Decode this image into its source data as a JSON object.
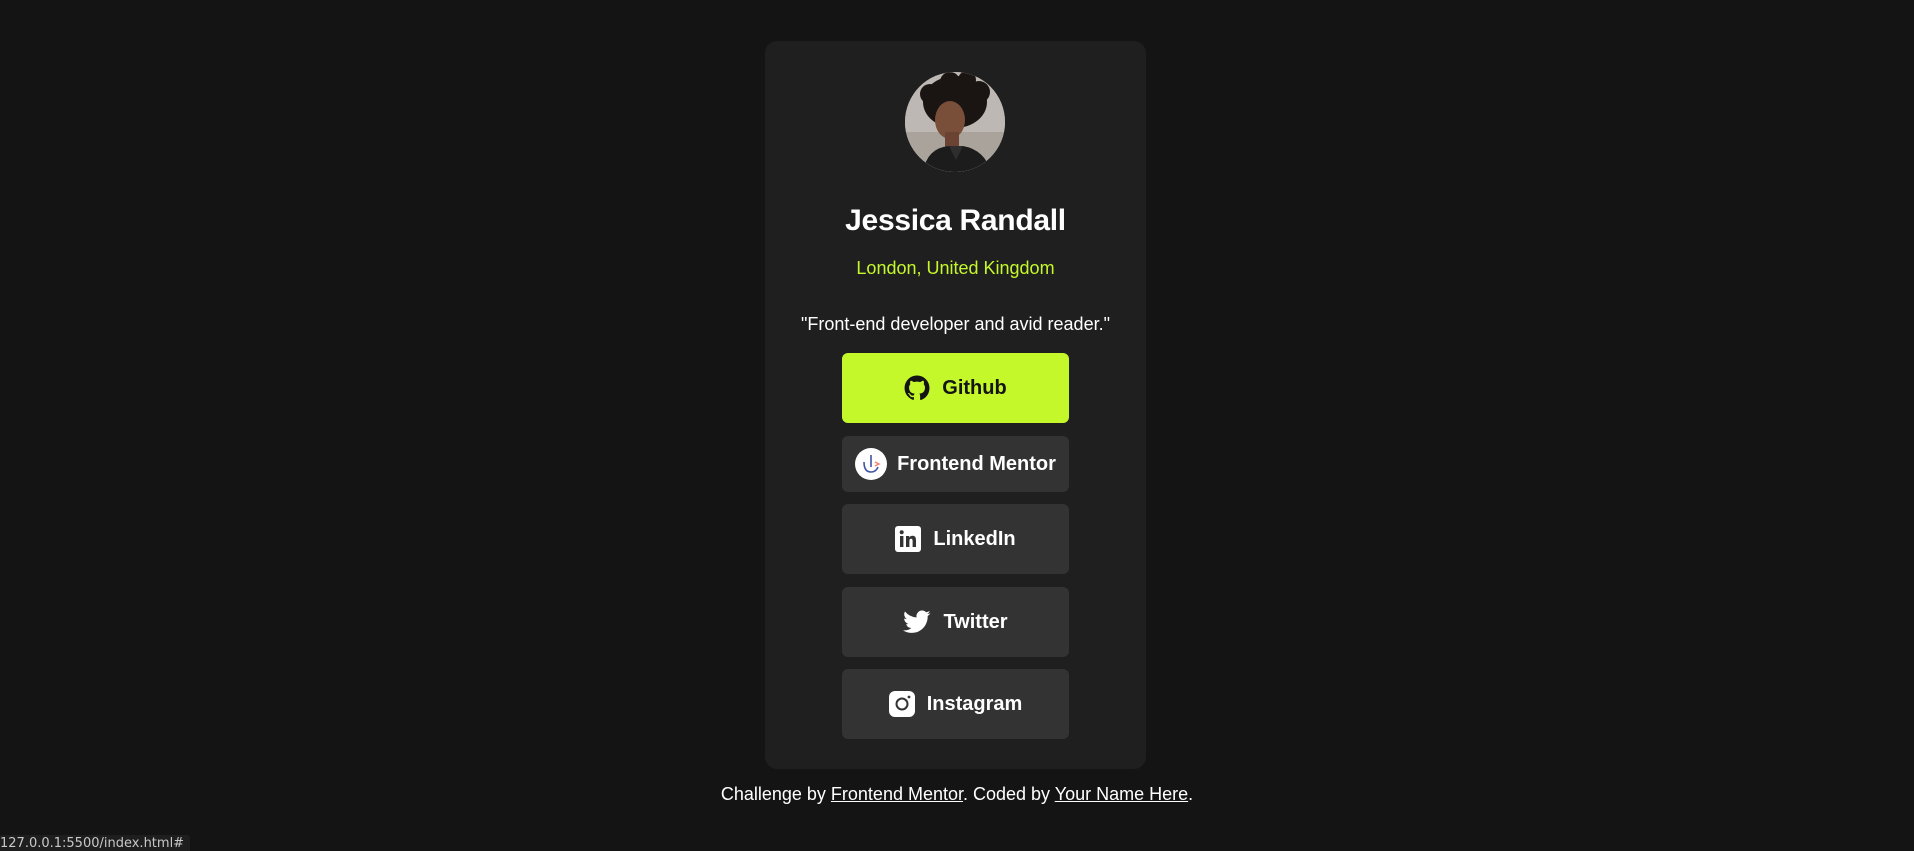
{
  "profile": {
    "name": "Jessica Randall",
    "location": "London, United Kingdom",
    "bio": "\"Front-end developer and avid reader.\""
  },
  "links": {
    "github": "Github",
    "frontend_mentor": "Frontend Mentor",
    "linkedin": "LinkedIn",
    "twitter": "Twitter",
    "instagram": "Instagram"
  },
  "footer": {
    "prefix": "Challenge by ",
    "challenge_link": "Frontend Mentor",
    "middle": ". Coded by ",
    "author_link": "Your Name Here",
    "suffix": "."
  },
  "status_bar": {
    "url": "127.0.0.1:5500/index.html#"
  },
  "colors": {
    "background": "#141414",
    "card": "#1f1f1f",
    "accent": "#c4f82a",
    "button": "#333333"
  },
  "icons": [
    "github-icon",
    "frontend-mentor-icon",
    "linkedin-icon",
    "twitter-icon",
    "instagram-icon"
  ]
}
